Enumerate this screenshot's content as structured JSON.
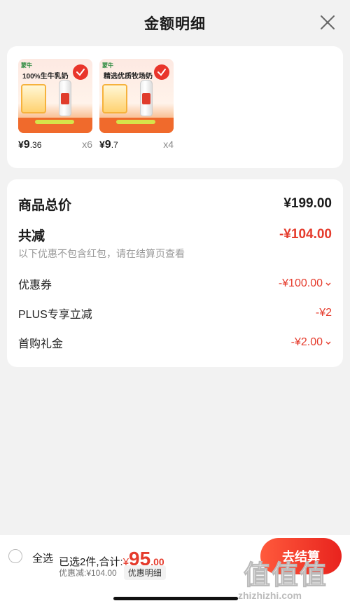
{
  "header": {
    "title": "金额明细"
  },
  "products": [
    {
      "brand": "蒙牛",
      "tagline": "100%生牛乳奶",
      "price_symbol": "¥",
      "price_int": "9",
      "price_dec": ".36",
      "qty": "x6"
    },
    {
      "brand": "蒙牛",
      "tagline": "精选优质牧场奶",
      "price_symbol": "¥",
      "price_int": "9",
      "price_dec": ".7",
      "qty": "x4"
    }
  ],
  "summary": {
    "total_label": "商品总价",
    "total_value": "¥199.00",
    "reduce_label": "共减",
    "reduce_value": "-¥104.00",
    "note": "以下优惠不包含红包，请在结算页查看",
    "items": [
      {
        "label": "优惠券",
        "value": "-¥100.00",
        "expandable": true
      },
      {
        "label": "PLUS专享立减",
        "value": "-¥2",
        "expandable": false
      },
      {
        "label": "首购礼金",
        "value": "-¥2.00",
        "expandable": true
      }
    ]
  },
  "bottom": {
    "select_all": "全选",
    "selected_text": "已选2件,合计:",
    "sum_symbol": "¥",
    "sum_int": "95",
    "sum_dec": ".00",
    "discount_text": "优惠减:¥104.00",
    "detail_label": "优惠明细",
    "checkout_label": "去结算"
  },
  "watermark": {
    "text": "值值值",
    "url": "zhizhizhi.com"
  },
  "colors": {
    "accent": "#e53b2c",
    "background": "#f2f2f2"
  }
}
